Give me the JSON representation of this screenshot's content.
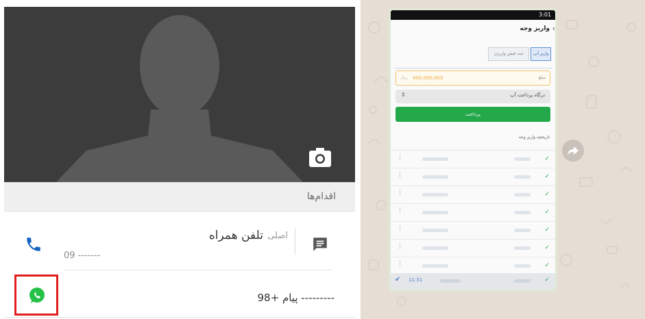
{
  "contact": {
    "actions_label": "اقدام‌ها",
    "phone": {
      "title": "تلفن همراه",
      "subtitle": "اصلی",
      "number": "09 -------"
    },
    "whatsapp": {
      "text": "پیام +98 ---------"
    }
  },
  "chat": {
    "screenshot": {
      "status_time": "3:01",
      "header_title": "واریز وجه",
      "tabs": [
        "واریز آنی",
        "ثبت فیش واریزی"
      ],
      "amount_label": "مبلغ",
      "amount_value": "400,000,000",
      "amount_unit": "ریال",
      "gateway_label": "درگاه پرداخت آپ",
      "gateway_chevron": "⇕",
      "pay_button": "پرداخت",
      "history_label": "تاریخچه واریز وجه",
      "footer_time": "11:31"
    }
  },
  "colors": {
    "whatsapp_highlight": "#e11e1e",
    "pay_green": "#23a84a",
    "phone_blue": "#1565c0"
  }
}
